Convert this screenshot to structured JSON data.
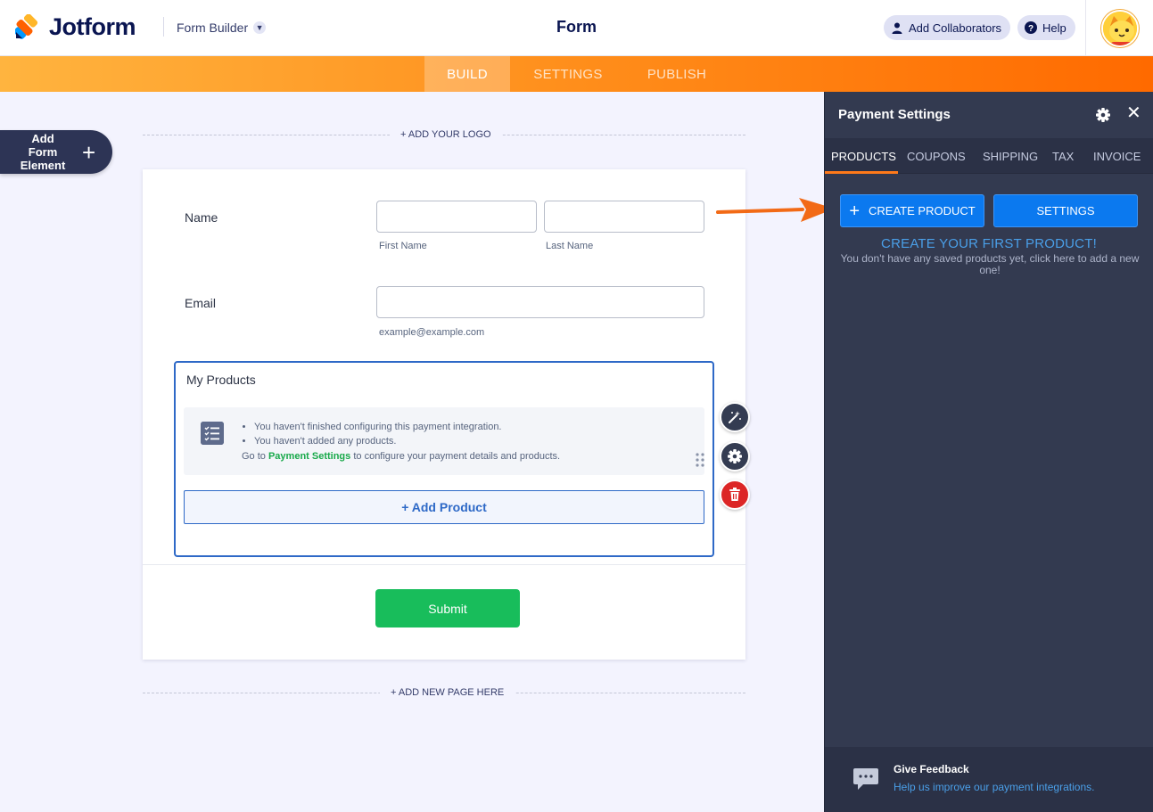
{
  "header": {
    "logo_text": "Jotform",
    "builder_label": "Form Builder",
    "form_title": "Form",
    "add_collaborators": "Add Collaborators",
    "help": "Help"
  },
  "nav": {
    "tabs": [
      {
        "label": "BUILD",
        "active": true
      },
      {
        "label": "SETTINGS",
        "active": false
      },
      {
        "label": "PUBLISH",
        "active": false
      }
    ]
  },
  "canvas": {
    "add_form_element": "Add Form Element",
    "add_logo": "+ ADD YOUR LOGO",
    "add_new_page": "+ ADD NEW PAGE HERE"
  },
  "form": {
    "name_label": "Name",
    "first_name_sublabel": "First Name",
    "last_name_sublabel": "Last Name",
    "email_label": "Email",
    "email_sublabel": "example@example.com",
    "products": {
      "title": "My Products",
      "notices": [
        "You haven't finished configuring this payment integration.",
        "You haven't added any products."
      ],
      "go_to_prefix": "Go to",
      "go_to_link": "Payment Settings",
      "go_to_suffix": "to configure your payment details and products.",
      "add_product": "+ Add Product"
    },
    "submit": "Submit"
  },
  "panel": {
    "title": "Payment Settings",
    "tabs": [
      {
        "label": "PRODUCTS",
        "active": true
      },
      {
        "label": "COUPONS",
        "active": false
      },
      {
        "label": "SHIPPING",
        "active": false
      },
      {
        "label": "TAX",
        "active": false
      },
      {
        "label": "INVOICE",
        "active": false
      }
    ],
    "create_product": "CREATE PRODUCT",
    "settings": "SETTINGS",
    "first_product_title": "CREATE YOUR FIRST PRODUCT!",
    "first_product_desc": "You don't have any saved products yet, click here to add a new one!",
    "feedback_title": "Give Feedback",
    "feedback_link": "Help us improve our payment integrations."
  },
  "colors": {
    "accent_orange": "#ff6a00",
    "primary_blue": "#0b79ef",
    "submit_green": "#18bd5b",
    "delete_red": "#dc2626"
  },
  "icons": [
    "jotform-logo-icon",
    "chevron-down-icon",
    "user-icon",
    "help-icon",
    "avatar",
    "plus-icon",
    "list-icon",
    "drag-handle-icon",
    "wand-icon",
    "gear-icon",
    "trash-icon",
    "close-icon",
    "arrow-icon",
    "feedback-icon"
  ]
}
